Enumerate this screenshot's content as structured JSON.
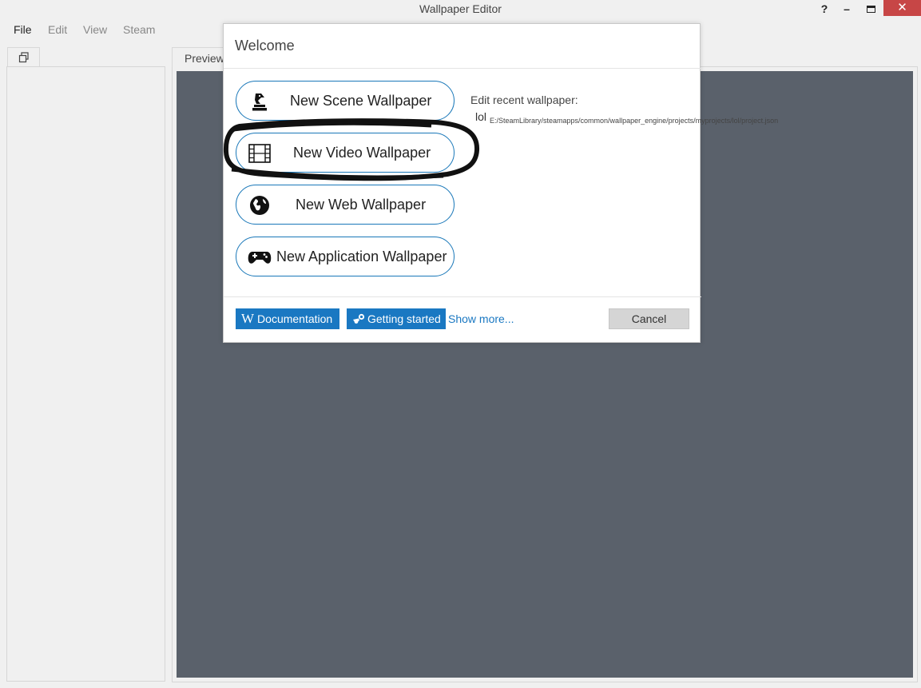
{
  "window": {
    "title": "Wallpaper Editor",
    "help_label": "?",
    "minimize_label": "–",
    "close_label": "✕"
  },
  "menubar": {
    "items": [
      "File",
      "Edit",
      "View",
      "Steam"
    ]
  },
  "tabs": {
    "preview_label": "Preview"
  },
  "dialog": {
    "title": "Welcome",
    "buttons": [
      {
        "label": "New Scene Wallpaper",
        "icon": "chess-knight-icon"
      },
      {
        "label": "New Video Wallpaper",
        "icon": "film-icon"
      },
      {
        "label": "New Web Wallpaper",
        "icon": "globe-icon"
      },
      {
        "label": "New Application Wallpaper",
        "icon": "gamepad-icon"
      }
    ],
    "recent": {
      "label": "Edit recent wallpaper:",
      "item_name": "lol",
      "item_path": "E:/SteamLibrary/steamapps/common/wallpaper_engine/projects/myprojects/lol/project.json"
    },
    "footer": {
      "documentation_label": "Documentation",
      "getting_started_label": "Getting started",
      "show_more_label": "Show more...",
      "cancel_label": "Cancel"
    }
  },
  "colors": {
    "accent": "#1a78c2",
    "preview_bg": "#5a616b",
    "close_button": "#c74646"
  }
}
